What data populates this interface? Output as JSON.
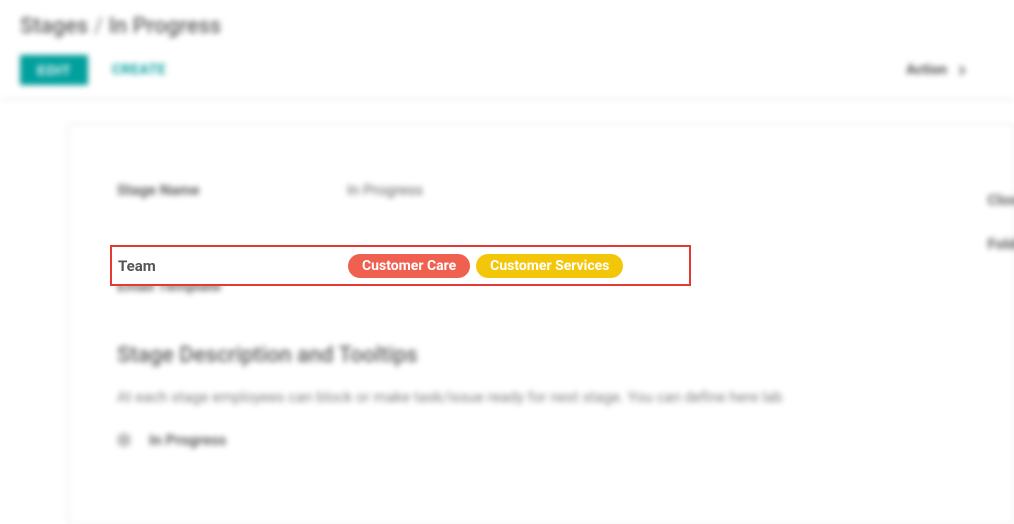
{
  "breadcrumb": {
    "parent": "Stages",
    "separator": "/",
    "current": "In Progress"
  },
  "toolbar": {
    "edit_label": "EDIT",
    "create_label": "CREATE",
    "action_label": "Action"
  },
  "form": {
    "stage_name_label": "Stage Name",
    "stage_name_value": "In Progress",
    "team_label": "Team",
    "team_tags": [
      {
        "text": "Customer Care",
        "color": "#F06050"
      },
      {
        "text": "Customer Services",
        "color": "#F4C609"
      }
    ],
    "email_template_label": "Email Template",
    "closing_label": "Closin",
    "folded_label": "Folded"
  },
  "section": {
    "title": "Stage Description and Tooltips",
    "description": "At each stage employees can block or make task/issue ready for next stage. You can define here lab",
    "sub_progress": "In Progress"
  }
}
